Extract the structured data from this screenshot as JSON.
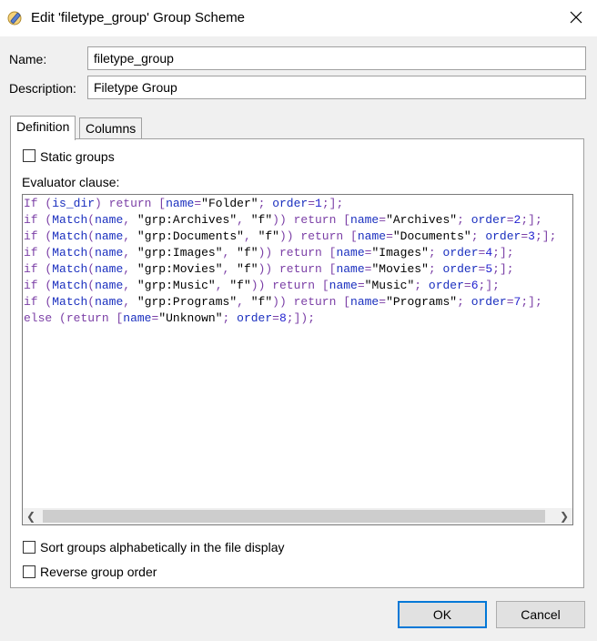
{
  "window": {
    "title": "Edit 'filetype_group' Group Scheme",
    "icon": "pencil-edit-icon"
  },
  "form": {
    "name_label": "Name:",
    "name_value": "filetype_group",
    "description_label": "Description:",
    "description_value": "Filetype Group"
  },
  "tabs": [
    {
      "label": "Definition",
      "active": true
    },
    {
      "label": "Columns",
      "active": false
    }
  ],
  "definition": {
    "static_groups_label": "Static groups",
    "static_groups_checked": false,
    "evaluator_label": "Evaluator clause:",
    "code_lines": [
      "If (is_dir) return [name=\"Folder\"; order=1;];",
      "if (Match(name, \"grp:Archives\", \"f\")) return [name=\"Archives\"; order=2;];",
      "if (Match(name, \"grp:Documents\", \"f\")) return [name=\"Documents\"; order=3;];",
      "if (Match(name, \"grp:Images\", \"f\")) return [name=\"Images\"; order=4;];",
      "if (Match(name, \"grp:Movies\", \"f\")) return [name=\"Movies\"; order=5;];",
      "if (Match(name, \"grp:Music\", \"f\")) return [name=\"Music\"; order=6;];",
      "if (Match(name, \"grp:Programs\", \"f\")) return [name=\"Programs\"; order=7;];",
      "else (return [name=\"Unknown\"; order=8;]);"
    ],
    "sort_label": "Sort groups alphabetically in the file display",
    "sort_checked": false,
    "reverse_label": "Reverse group order",
    "reverse_checked": false
  },
  "buttons": {
    "ok": "OK",
    "cancel": "Cancel"
  },
  "colors": {
    "keyword": "#7b3fa6",
    "identifier": "#1a2fbf",
    "number": "#2323d0",
    "default_button_border": "#0078d7"
  }
}
